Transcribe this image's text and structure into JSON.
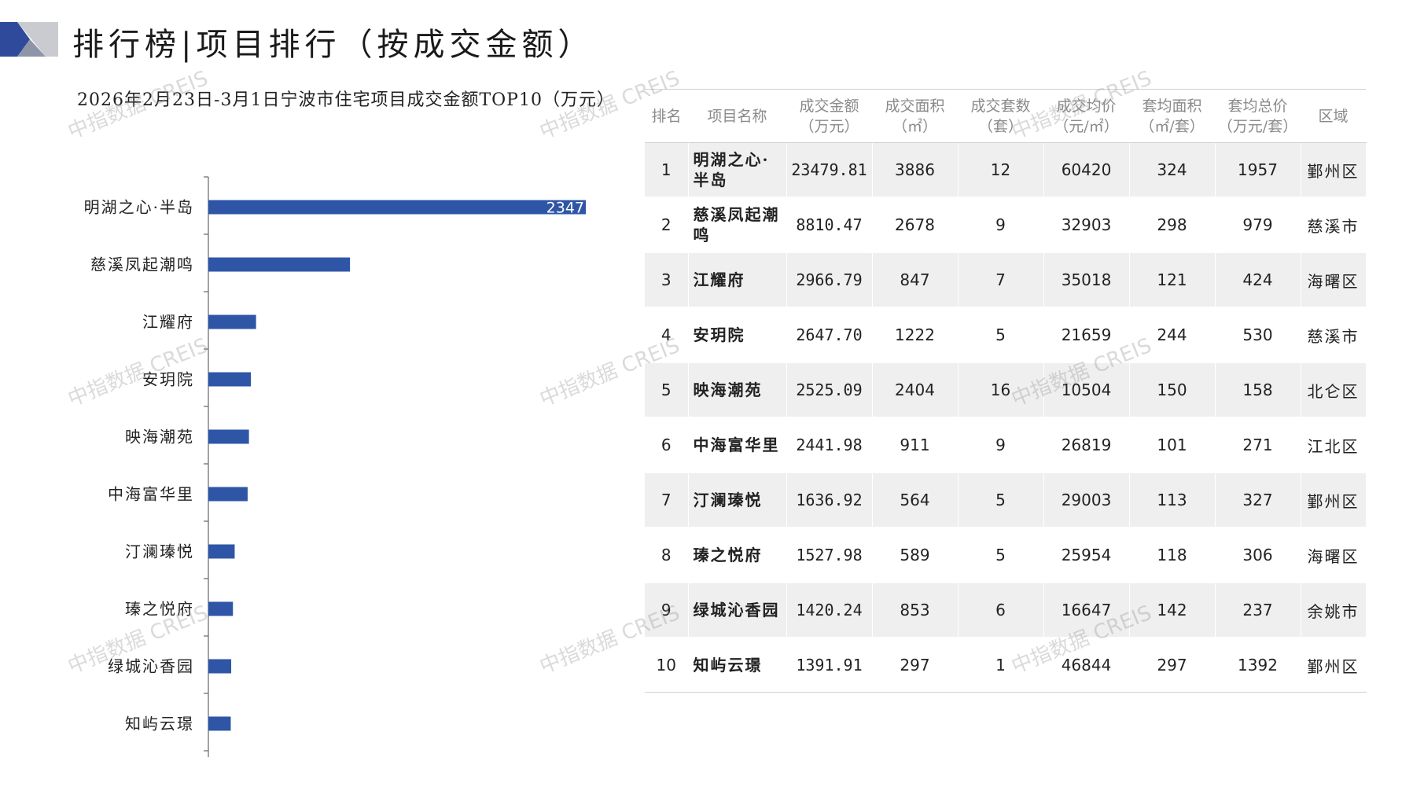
{
  "header": {
    "title": "排行榜|项目排行（按成交金额）"
  },
  "chart_data": {
    "type": "bar",
    "orientation": "horizontal",
    "title": "2026年2月23日-3月1日宁波市住宅项目成交金额TOP10（万元）",
    "categories": [
      "明湖之心·半岛",
      "慈溪凤起潮鸣",
      "江耀府",
      "安玥院",
      "映海潮苑",
      "中海富华里",
      "汀澜瑧悦",
      "瑧之悦府",
      "绿城沁香园",
      "知屿云璟"
    ],
    "values": [
      23479.81,
      8810.47,
      2966.79,
      2647.7,
      2525.09,
      2441.98,
      1636.92,
      1527.98,
      1420.24,
      1391.91
    ],
    "data_labels": [
      "2347",
      "",
      "",
      "",
      "",
      "",
      "",
      "",
      "",
      ""
    ],
    "bar_color": "#2f56a6",
    "xlim": [
      0,
      23479.81
    ],
    "grid": false,
    "legend": "none"
  },
  "table": {
    "headers": [
      [
        "排名"
      ],
      [
        "项目名称"
      ],
      [
        "成交金额",
        "（万元）"
      ],
      [
        "成交面积",
        "（㎡）"
      ],
      [
        "成交套数",
        "（套）"
      ],
      [
        "成交均价",
        "（元/㎡）"
      ],
      [
        "套均面积",
        "（㎡/套）"
      ],
      [
        "套均总价",
        "（万元/套）"
      ],
      [
        "区域"
      ]
    ],
    "rows": [
      {
        "rank": "1",
        "name": "明湖之心·半岛",
        "amount": "23479.81",
        "area": "3886",
        "units": "12",
        "avg_price": "60420",
        "avg_area": "324",
        "avg_total": "1957",
        "region": "鄞州区"
      },
      {
        "rank": "2",
        "name": "慈溪凤起潮鸣",
        "amount": "8810.47",
        "area": "2678",
        "units": "9",
        "avg_price": "32903",
        "avg_area": "298",
        "avg_total": "979",
        "region": "慈溪市"
      },
      {
        "rank": "3",
        "name": "江耀府",
        "amount": "2966.79",
        "area": "847",
        "units": "7",
        "avg_price": "35018",
        "avg_area": "121",
        "avg_total": "424",
        "region": "海曙区"
      },
      {
        "rank": "4",
        "name": "安玥院",
        "amount": "2647.70",
        "area": "1222",
        "units": "5",
        "avg_price": "21659",
        "avg_area": "244",
        "avg_total": "530",
        "region": "慈溪市"
      },
      {
        "rank": "5",
        "name": "映海潮苑",
        "amount": "2525.09",
        "area": "2404",
        "units": "16",
        "avg_price": "10504",
        "avg_area": "150",
        "avg_total": "158",
        "region": "北仑区"
      },
      {
        "rank": "6",
        "name": "中海富华里",
        "amount": "2441.98",
        "area": "911",
        "units": "9",
        "avg_price": "26819",
        "avg_area": "101",
        "avg_total": "271",
        "region": "江北区"
      },
      {
        "rank": "7",
        "name": "汀澜瑧悦",
        "amount": "1636.92",
        "area": "564",
        "units": "5",
        "avg_price": "29003",
        "avg_area": "113",
        "avg_total": "327",
        "region": "鄞州区"
      },
      {
        "rank": "8",
        "name": "瑧之悦府",
        "amount": "1527.98",
        "area": "589",
        "units": "5",
        "avg_price": "25954",
        "avg_area": "118",
        "avg_total": "306",
        "region": "海曙区"
      },
      {
        "rank": "9",
        "name": "绿城沁香园",
        "amount": "1420.24",
        "area": "853",
        "units": "6",
        "avg_price": "16647",
        "avg_area": "142",
        "avg_total": "237",
        "region": "余姚市"
      },
      {
        "rank": "10",
        "name": "知屿云璟",
        "amount": "1391.91",
        "area": "297",
        "units": "1",
        "avg_price": "46844",
        "avg_area": "297",
        "avg_total": "1392",
        "region": "鄞州区"
      }
    ]
  },
  "watermark": {
    "text": "中指数据 CREIS"
  },
  "colors": {
    "accent_blue": "#2f56a6",
    "logo_gray": "#c9cbd1",
    "row_stripe": "#efefef"
  }
}
